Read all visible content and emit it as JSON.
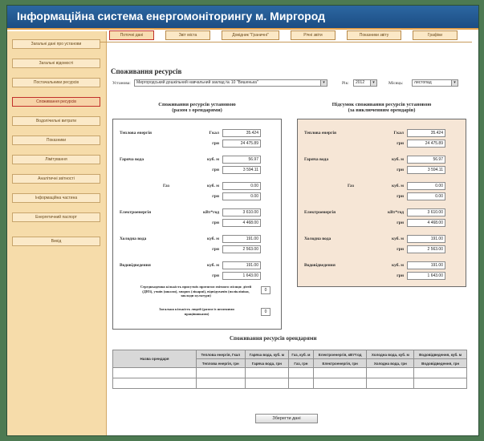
{
  "header": {
    "title": "Інформаційна система енергомоніторингу м. Миргород"
  },
  "sidebar": {
    "items": [
      {
        "label": "Загальні дані про установи"
      },
      {
        "label": "Загальні відомості"
      },
      {
        "label": "Постачальники ресурсів"
      },
      {
        "label": "Споживання ресурсів"
      },
      {
        "label": "Водолічильні витрати"
      },
      {
        "label": "Показники"
      },
      {
        "label": "Лімітування"
      },
      {
        "label": "Аналітичні звітності"
      },
      {
        "label": "Інформаційна частина"
      },
      {
        "label": "Енергетичний паспорт"
      },
      {
        "label": "Вихід"
      }
    ]
  },
  "tabs": [
    {
      "label": "Поточні дані"
    },
    {
      "label": "Звіт міста"
    },
    {
      "label": "Довідник \"Граничні\""
    },
    {
      "label": "Річні звіти"
    },
    {
      "label": "Показники звіту"
    },
    {
      "label": "Графіки"
    }
  ],
  "main": {
    "title": "Споживання ресурсів",
    "filters": {
      "institution_label": "Установа:",
      "institution_value": "Миргородський дошкільний навчальний заклад № 10 \"Вишенька\"",
      "year_label": "Рік:",
      "year_value": "2012",
      "month_label": "Місяць:",
      "month_value": "листопад"
    }
  },
  "left_panel": {
    "title_line1": "Споживання ресурсів установою",
    "title_line2": "(разом з орендарями)",
    "resources": [
      {
        "name": "Теплова енергія",
        "unit1": "Гкал",
        "value1": "35.424",
        "unit2": "грн",
        "value2": "24 475.89"
      },
      {
        "name": "Гаряча вода",
        "unit1": "куб. м",
        "value1": "56.97",
        "unit2": "грн",
        "value2": "3 594.11"
      },
      {
        "name": "Газ",
        "unit1": "куб. м",
        "value1": "0.00",
        "unit2": "грн",
        "value2": "0.00"
      },
      {
        "name": "Електроенергія",
        "unit1": "кВт*год",
        "value1": "3 610.00",
        "unit2": "грн",
        "value2": "4 468.00"
      },
      {
        "name": "Холодна вода",
        "unit1": "куб. м",
        "value1": "191.00",
        "unit2": "грн",
        "value2": "2 563.00"
      },
      {
        "name": "Водовідведення",
        "unit1": "куб. м",
        "value1": "191.00",
        "unit2": "грн",
        "value2": "1 643.00"
      }
    ],
    "note1": "Середньоденна кількість присутніх протягом звітного місяця: дітей (ДНЗ), учнів (школи), хворих (лікарні), відвідувачів (поліклініки, заклади культури)",
    "note1_value": "0",
    "note2": "Загальна кількість людей (разом із штатними працівниками)",
    "note2_value": "0"
  },
  "right_panel": {
    "title_line1": "Підсумок споживання ресурсів установою",
    "title_line2": "(за виключенням орендарів)",
    "resources": [
      {
        "name": "Теплова енергія",
        "unit1": "Гкал",
        "value1": "35.424",
        "unit2": "грн",
        "value2": "24 475.89"
      },
      {
        "name": "Гаряча вода",
        "unit1": "куб. м",
        "value1": "56.97",
        "unit2": "грн",
        "value2": "3 594.11"
      },
      {
        "name": "Газ",
        "unit1": "куб. м",
        "value1": "0.00",
        "unit2": "грн",
        "value2": "0.00"
      },
      {
        "name": "Електроенергія",
        "unit1": "кВт*год",
        "value1": "3 610.00",
        "unit2": "грн",
        "value2": "4 468.00"
      },
      {
        "name": "Холодна вода",
        "unit1": "куб. м",
        "value1": "191.00",
        "unit2": "грн",
        "value2": "2 563.00"
      },
      {
        "name": "Водовідведення",
        "unit1": "куб. м",
        "value1": "191.00",
        "unit2": "грн",
        "value2": "1 643.00"
      }
    ]
  },
  "rent_section": {
    "title": "Споживання ресурсів орендарями",
    "col0": "Назва орендаря",
    "headers_top": [
      "Теплова енергія, Гкал",
      "Гаряча вода, куб. м",
      "Газ, куб. м",
      "Електроенергія, кВт*год",
      "Холодна вода, куб. м",
      "Водовідведення, куб. м"
    ],
    "headers_bottom": [
      "Теплова енергія, грн",
      "Гаряча вода, грн",
      "Газ, грн",
      "Електроенергія, грн",
      "Холодна вода, грн",
      "Водовідведення, грн"
    ]
  },
  "actions": {
    "save_label": "Зберегти дані"
  }
}
